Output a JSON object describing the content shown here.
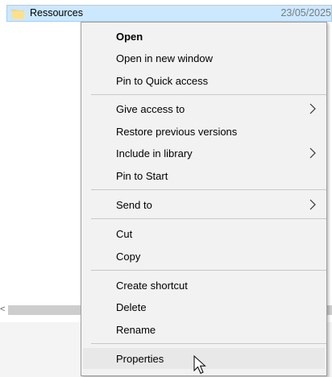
{
  "file": {
    "name": "Ressources",
    "date": "23/05/2025",
    "icon": "folder-icon"
  },
  "context_menu": {
    "items": [
      {
        "label": "Open",
        "bold": true
      },
      {
        "label": "Open in new window"
      },
      {
        "label": "Pin to Quick access"
      },
      {
        "label": "Give access to",
        "submenu": true
      },
      {
        "label": "Restore previous versions"
      },
      {
        "label": "Include in library",
        "submenu": true
      },
      {
        "label": "Pin to Start"
      },
      {
        "label": "Send to",
        "submenu": true
      },
      {
        "label": "Cut"
      },
      {
        "label": "Copy"
      },
      {
        "label": "Create shortcut"
      },
      {
        "label": "Delete"
      },
      {
        "label": "Rename"
      },
      {
        "label": "Properties",
        "hovered": true
      }
    ]
  },
  "scrollbar": {
    "left_arrow": "<"
  },
  "colors": {
    "selection": "#cce8ff",
    "menu_bg": "#f2f2f2",
    "hover": "#e8e8e8"
  }
}
